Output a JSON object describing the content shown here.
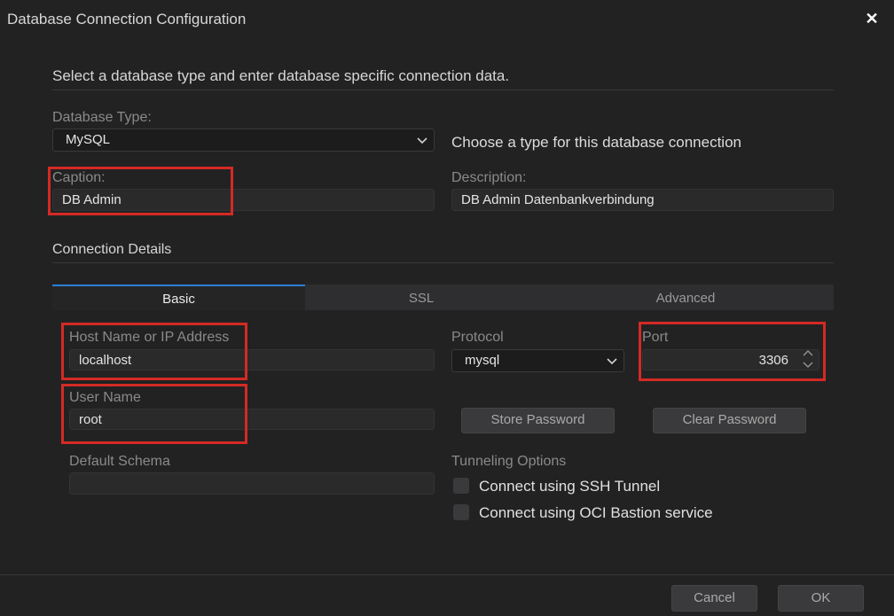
{
  "dialog": {
    "title": "Database Connection Configuration",
    "intro": "Select a database type and enter database specific connection data."
  },
  "database_type": {
    "label": "Database Type:",
    "value": "MySQL",
    "hint": "Choose a type for this database connection"
  },
  "caption": {
    "label": "Caption:",
    "value": "DB Admin"
  },
  "description": {
    "label": "Description:",
    "value": "DB Admin Datenbankverbindung"
  },
  "connection_details": {
    "heading": "Connection Details"
  },
  "tabs": [
    {
      "label": "Basic",
      "active": true
    },
    {
      "label": "SSL",
      "active": false
    },
    {
      "label": "Advanced",
      "active": false
    }
  ],
  "host": {
    "label": "Host Name or IP Address",
    "value": "localhost"
  },
  "protocol": {
    "label": "Protocol",
    "value": "mysql"
  },
  "port": {
    "label": "Port",
    "value": "3306"
  },
  "user": {
    "label": "User Name",
    "value": "root"
  },
  "buttons": {
    "store_password": "Store Password",
    "clear_password": "Clear Password",
    "cancel": "Cancel",
    "ok": "OK"
  },
  "schema": {
    "label": "Default Schema",
    "value": ""
  },
  "tunneling": {
    "label": "Tunneling Options",
    "options": [
      {
        "label": "Connect using SSH Tunnel",
        "checked": false
      },
      {
        "label": "Connect using OCI Bastion service",
        "checked": false
      }
    ]
  },
  "icons": {
    "close": "close-icon",
    "dropdown": "chevron-down-icon",
    "spinner_up": "chevron-up-icon",
    "spinner_down": "chevron-down-icon"
  },
  "colors": {
    "background": "#222223",
    "accent": "#2b7fd6",
    "highlight_box": "#d42a24"
  }
}
